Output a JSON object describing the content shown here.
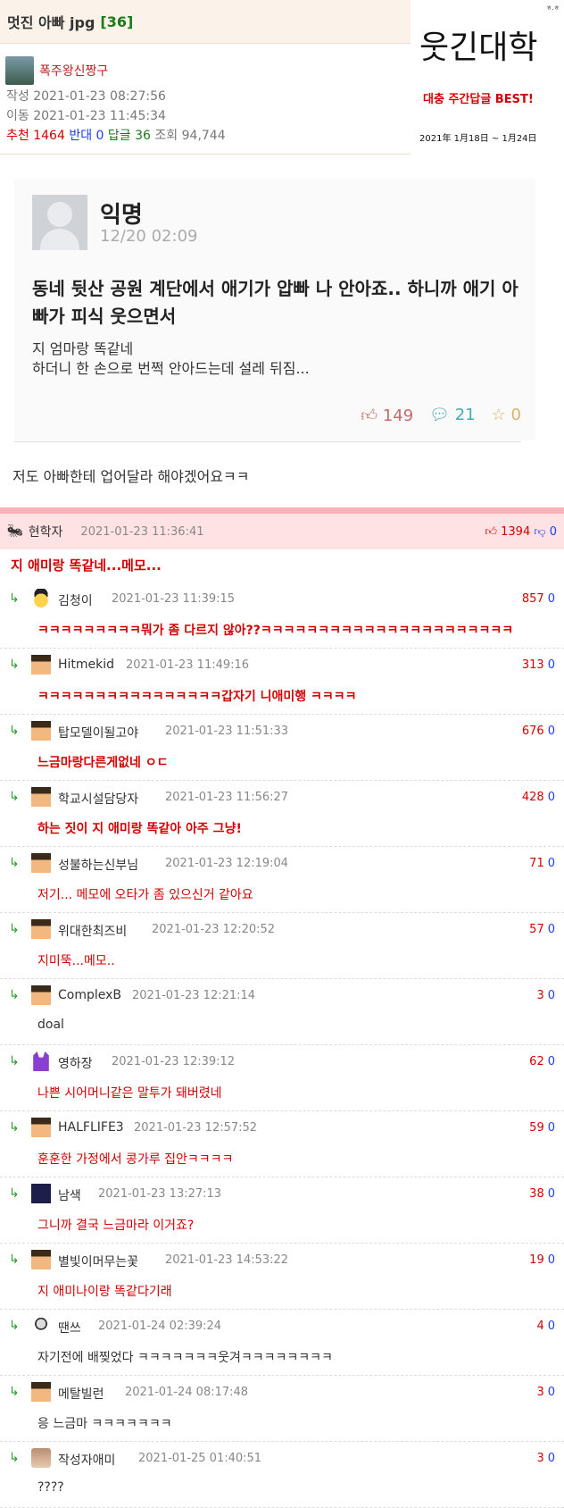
{
  "post": {
    "title": "멋진 아빠 jpg",
    "count": "[36]",
    "author": "폭주왕신짱구",
    "created_label": "작성",
    "created": "2021-01-23 08:27:56",
    "moved_label": "이동",
    "moved": "2021-01-23 11:45:34",
    "recommend_label": "추천",
    "recommend": "1464",
    "oppose_label": "반대",
    "oppose": "0",
    "reply_label": "답글",
    "reply_count": "36",
    "views_label": "조회",
    "views": "94,744",
    "text": "저도 아빠한테 업어달라 해야겠어요ㅋㅋ"
  },
  "logo": {
    "title": "웃긴대학",
    "sub": "대충 주간답글 BEST!",
    "date": "2021年 1月18日 ~ 1月24日",
    "mark": "ㅎ.ㅎ"
  },
  "card": {
    "name": "익명",
    "date": "12/20 02:09",
    "title": "동네 뒷산 공원 계단에서 애기가 압빠 나 안아죠.. 하니까 애기 아빠가 피식 웃으면서",
    "body1": "지 엄마랑 똑같네",
    "body2": "하더니 한 손으로 번쩍 안아드는데 설레 뒤짐...",
    "likes": "149",
    "comments": "21",
    "stars": "0"
  },
  "best": {
    "name": "현학자",
    "date": "2021-01-23 11:36:41",
    "up": "1394",
    "down": "0",
    "text": "지 애미랑 똑같네...메모..."
  },
  "replies": [
    {
      "name": "김청이",
      "date": "2021-01-23 11:39:15",
      "up": "857",
      "down": "0",
      "text": "ㅋㅋㅋㅋㅋㅋㅋㅋㅋ뭐가 좀 다르지 않아??ㅋㅋㅋㅋㅋㅋㅋㅋㅋㅋㅋㅋㅋㅋㅋㅋㅋㅋㅋㅋㅋㅋ"
    },
    {
      "name": "Hitmekid",
      "date": "2021-01-23 11:49:16",
      "up": "313",
      "down": "0",
      "text": "ㅋㅋㅋㅋㅋㅋㅋㅋㅋㅋㅋㅋㅋㅋㅋㅋ갑자기 니애미행 ㅋㅋㅋㅋ"
    },
    {
      "name": "탑모델이될고야",
      "date": "2021-01-23 11:51:33",
      "up": "676",
      "down": "0",
      "text": "느금마랑다른게없네 ㅇㄷ"
    },
    {
      "name": "학교시설담당자",
      "date": "2021-01-23 11:56:27",
      "up": "428",
      "down": "0",
      "text": "하는 짓이 지 애미랑 똑같아 아주 그냥!"
    },
    {
      "name": "성불하는신부님",
      "date": "2021-01-23 12:19:04",
      "up": "71",
      "down": "0",
      "text": "저기... 메모에 오타가 좀 있으신거 같아요"
    },
    {
      "name": "위대한최즈비",
      "date": "2021-01-23 12:20:52",
      "up": "57",
      "down": "0",
      "text": "지미뚝...메모.."
    },
    {
      "name": "ComplexB",
      "date": "2021-01-23 12:21:14",
      "up": "3",
      "down": "0",
      "text": "doal"
    },
    {
      "name": "영하장",
      "date": "2021-01-23 12:39:12",
      "up": "62",
      "down": "0",
      "text": "나쁜 시어머니같은 말투가 돼버렸네"
    },
    {
      "name": "HALFLIFE3",
      "date": "2021-01-23 12:57:52",
      "up": "59",
      "down": "0",
      "text": "훈훈한 가정에서 콩가루 집안ㅋㅋㅋㅋ"
    },
    {
      "name": "남색",
      "date": "2021-01-23 13:27:13",
      "up": "38",
      "down": "0",
      "text": "그니까 결국 느금마라 이거죠?"
    },
    {
      "name": "별빛이머무는꽃",
      "date": "2021-01-23 14:53:22",
      "up": "19",
      "down": "0",
      "text": "지 애미나이랑 똑같다기래"
    },
    {
      "name": "땐쓰",
      "date": "2021-01-24 02:39:24",
      "up": "4",
      "down": "0",
      "text": "자기전에 배찢었다 ㅋㅋㅋㅋㅋㅋㅋ웃겨ㅋㅋㅋㅋㅋㅋㅋㅋ"
    },
    {
      "name": "메탈빌런",
      "date": "2021-01-24 08:17:48",
      "up": "3",
      "down": "0",
      "text": "응 느금마 ㅋㅋㅋㅋㅋㅋㅋ"
    },
    {
      "name": "작성자애미",
      "date": "2021-01-25 01:40:51",
      "up": "3",
      "down": "0",
      "text": "????"
    }
  ]
}
